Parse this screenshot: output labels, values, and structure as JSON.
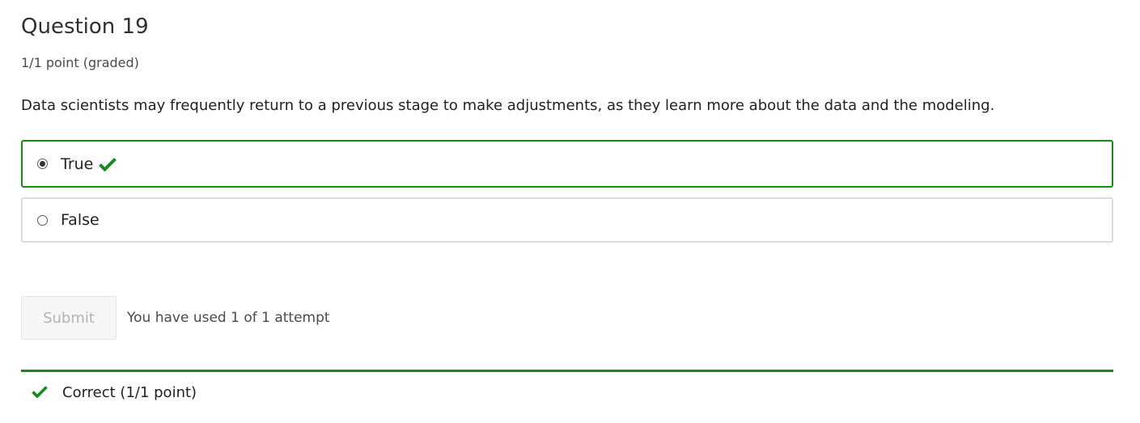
{
  "problem": {
    "title": "Question 19",
    "points": "1/1 point (graded)",
    "prompt": "Data scientists may frequently return to a previous stage to make adjustments, as they learn more about the data and the modeling.",
    "choices": [
      {
        "label": "True",
        "selected": true,
        "status": "correct"
      },
      {
        "label": "False",
        "selected": false,
        "status": "none"
      }
    ]
  },
  "actions": {
    "submit_label": "Submit",
    "submit_enabled": false,
    "attempts_text": "You have used 1 of 1 attempt"
  },
  "notification": {
    "text": "Correct (1/1 point)",
    "icon": "checkmark-icon"
  },
  "colors": {
    "correct": "#178a17",
    "border_default": "#dcdcdc",
    "text": "#313131"
  }
}
